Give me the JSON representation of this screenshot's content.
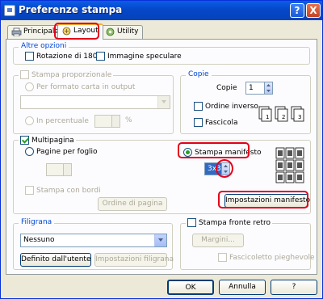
{
  "window": {
    "title": "Preferenze stampa"
  },
  "title_buttons": {
    "help": "?",
    "close": "X"
  },
  "tabs": [
    {
      "label": "Principale",
      "active": false
    },
    {
      "label": "Layout",
      "active": true
    },
    {
      "label": "Utility",
      "active": false
    }
  ],
  "altre_opzioni": {
    "legend": "Altre opzioni",
    "rotazione": "Rotazione di 180°",
    "speculare": "Immagine speculare"
  },
  "stampa_proporzionale": {
    "label": "Stampa proporzionale",
    "per_formato": "Per formato carta in output",
    "in_percentuale": "In percentuale",
    "percent_sign": "%"
  },
  "copie": {
    "legend": "Copie",
    "copie_label": "Copie",
    "copie_value": "1",
    "ordine_inverso": "Ordine inverso",
    "fascicola": "Fascicola"
  },
  "multipagina": {
    "label": "Multipagina",
    "pagine_per_foglio": "Pagine per foglio",
    "stampa_manifesto": "Stampa manifesto",
    "manifesto_value": "3x3",
    "stampa_con_bordi": "Stampa con bordi",
    "ordine_di_pagina": "Ordine di pagina",
    "impostazioni_manifesto": "Impostazioni manifesto"
  },
  "filigrana": {
    "legend": "Filigrana",
    "selected": "Nessuno",
    "definito_utente": "Definito dall'utente",
    "impostazioni_filigrana": "Impostazioni filigrana"
  },
  "fronte_retro": {
    "label": "Stampa fronte retro",
    "margini": "Margini...",
    "fascicoletto": "Fascicoletto pieghevole"
  },
  "footer": {
    "ok": "OK",
    "annulla": "Annulla",
    "help": "?"
  },
  "colors": {
    "highlight": "#e3001b",
    "titlebar": "#0a5ee6",
    "group_legend": "#0046d5"
  }
}
